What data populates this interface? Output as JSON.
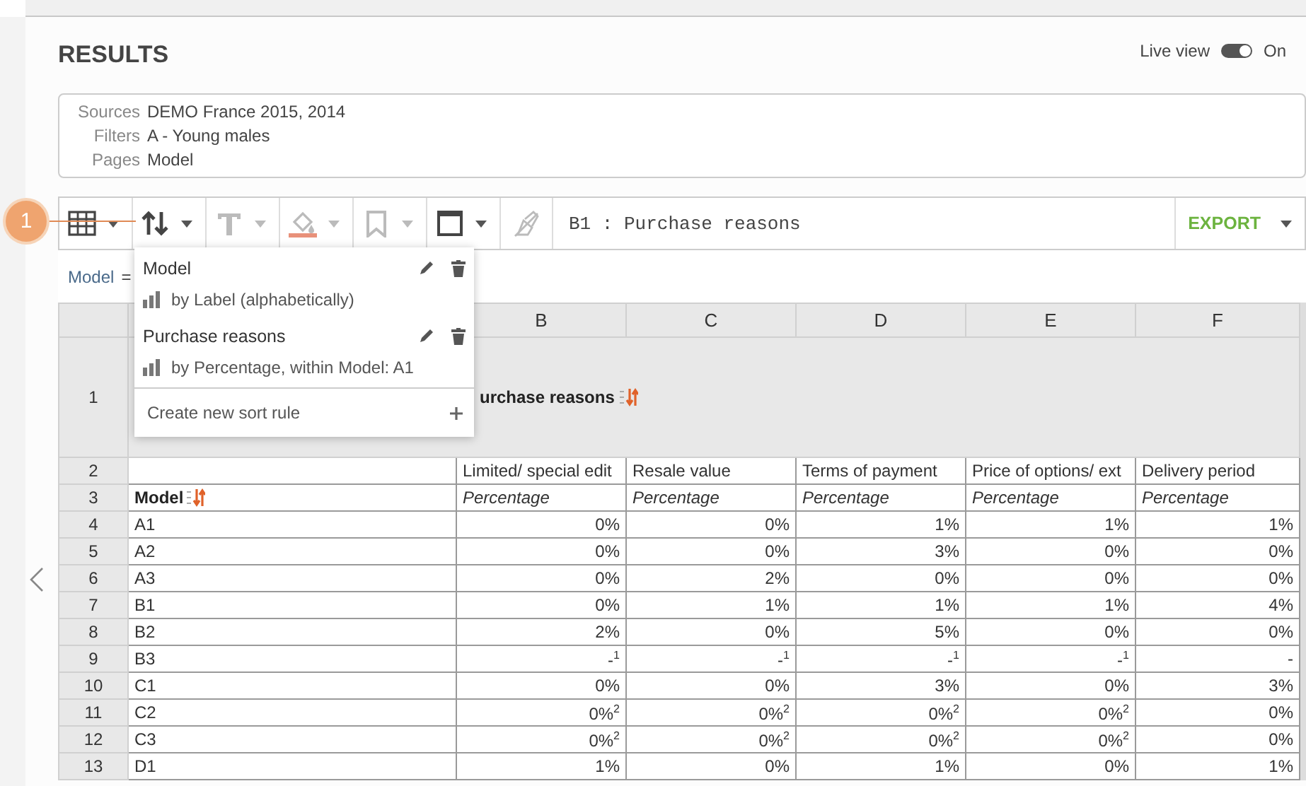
{
  "header": {
    "title": "RESULTS",
    "live_view": {
      "label": "Live view",
      "on": true,
      "state_text": "On"
    }
  },
  "info": [
    {
      "label": "Sources",
      "value": "DEMO France 2015, 2014"
    },
    {
      "label": "Filters",
      "value": "A - Young males"
    },
    {
      "label": "Pages",
      "value": "Model"
    }
  ],
  "callout": {
    "number": "1"
  },
  "toolbar": {
    "tools": [
      {
        "kind": "table",
        "disabled": false,
        "caret": true
      },
      {
        "kind": "sort",
        "disabled": false,
        "caret": true
      },
      {
        "kind": "text",
        "disabled": true,
        "caret": true
      },
      {
        "kind": "fill",
        "disabled": true,
        "caret": true
      },
      {
        "kind": "bookmark",
        "disabled": true,
        "caret": true
      },
      {
        "kind": "border",
        "disabled": false,
        "caret": true
      },
      {
        "kind": "clear",
        "disabled": true,
        "caret": false
      }
    ],
    "cell_ref": "B1 : Purchase reasons",
    "export": "EXPORT"
  },
  "formula": {
    "name": "Model",
    "operator": "="
  },
  "sort_menu": {
    "rules": [
      {
        "title": "Model",
        "description": "by Label (alphabetically)"
      },
      {
        "title": "Purchase reasons",
        "description": "by Percentage, within Model: A1"
      }
    ],
    "create": "Create new sort rule"
  },
  "table": {
    "columns": [
      "B",
      "C",
      "D",
      "E",
      "F"
    ],
    "title_row": {
      "number": "1",
      "text": "urchase reasons"
    },
    "label_row": {
      "number": "2",
      "labels": [
        "Limited/ special edit",
        "Resale value",
        "Terms of payment",
        "Price of options/ ext",
        "Delivery period"
      ]
    },
    "measure_row": {
      "number": "3",
      "label": "Model",
      "measures": [
        "Percentage",
        "Percentage",
        "Percentage",
        "Percentage",
        "Percentage"
      ]
    },
    "rows": [
      {
        "number": "4",
        "label": "A1",
        "values": [
          "0%",
          "0%",
          "1%",
          "1%",
          "1%"
        ]
      },
      {
        "number": "5",
        "label": "A2",
        "values": [
          "0%",
          "0%",
          "3%",
          "0%",
          "0%"
        ]
      },
      {
        "number": "6",
        "label": "A3",
        "values": [
          "0%",
          "2%",
          "0%",
          "0%",
          "0%"
        ]
      },
      {
        "number": "7",
        "label": "B1",
        "values": [
          "0%",
          "1%",
          "1%",
          "1%",
          "4%"
        ]
      },
      {
        "number": "8",
        "label": "B2",
        "values": [
          "2%",
          "0%",
          "5%",
          "0%",
          "0%"
        ]
      },
      {
        "number": "9",
        "label": "B3",
        "values": [
          "-$^{1}$",
          "-$^{1}$",
          "-$^{1}$",
          "-$^{1}$",
          "-"
        ]
      },
      {
        "number": "10",
        "label": "C1",
        "values": [
          "0%",
          "0%",
          "3%",
          "0%",
          "3%"
        ]
      },
      {
        "number": "11",
        "label": "C2",
        "values": [
          "0%$^{2}$",
          "0%$^{2}$",
          "0%$^{2}$",
          "0%$^{2}$",
          "0%"
        ]
      },
      {
        "number": "12",
        "label": "C3",
        "values": [
          "0%$^{2}$",
          "0%$^{2}$",
          "0%$^{2}$",
          "0%$^{2}$",
          "0%"
        ]
      },
      {
        "number": "13",
        "label": "D1",
        "values": [
          "1%",
          "0%",
          "1%",
          "0%",
          "1%"
        ]
      }
    ]
  }
}
